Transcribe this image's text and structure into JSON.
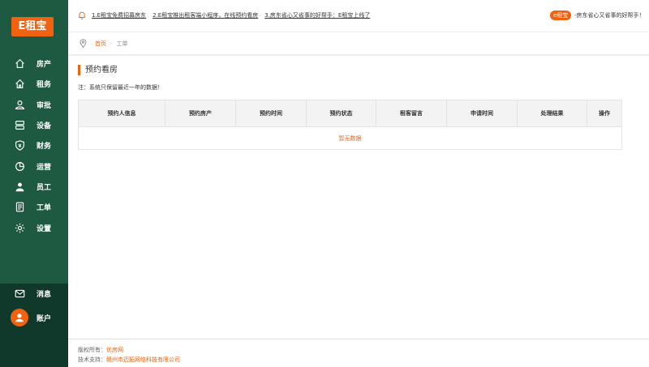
{
  "sidebar": {
    "logo": "E租宝",
    "items": [
      {
        "label": "房产",
        "icon": "home-icon"
      },
      {
        "label": "租务",
        "icon": "house-icon"
      },
      {
        "label": "审批",
        "icon": "user-check-icon"
      },
      {
        "label": "设备",
        "icon": "device-icon"
      },
      {
        "label": "财务",
        "icon": "finance-icon"
      },
      {
        "label": "运营",
        "icon": "pie-chart-icon"
      },
      {
        "label": "员工",
        "icon": "person-icon"
      },
      {
        "label": "工单",
        "icon": "document-icon"
      },
      {
        "label": "设置",
        "icon": "gear-icon"
      }
    ],
    "message_label": "消息",
    "account_label": "账户"
  },
  "topbar": {
    "notices": [
      "1.E租宝免费招募房东",
      "2.E租宝推出租客端小程序，在线预约看房",
      "3.房东省心又省事的好帮手：E租宝上线了"
    ],
    "brand_badge": "e租宝",
    "brand_slogan": "-房东省心又省事的好帮手！"
  },
  "breadcrumb": {
    "home": "首页",
    "sep": "-",
    "current": "工单"
  },
  "main": {
    "title": "预约看房",
    "note": "注：系统只保留最近一年的数据！",
    "table": {
      "columns": [
        "预约人信息",
        "预约房产",
        "预约时间",
        "预约状态",
        "租客留言",
        "申请时间",
        "处理结果",
        "操作"
      ],
      "empty_text": "暂无数据"
    }
  },
  "footer": {
    "copyright_label": "版权所有：",
    "copyright_value": "优房网",
    "support_label": "技术支持：",
    "support_value": "赣州市迈拓网络科技有限公司"
  },
  "colors": {
    "sidebar": "#1e5a42",
    "sidebar_bottom": "#11392b",
    "accent": "#f0620f"
  }
}
